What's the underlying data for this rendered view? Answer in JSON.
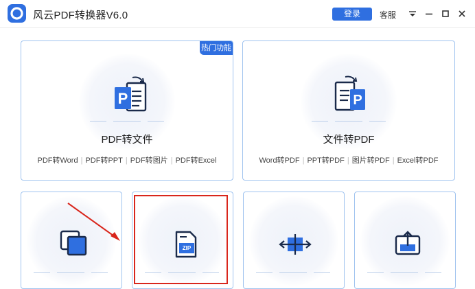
{
  "app": {
    "title": "风云PDF转换器V6.0",
    "login_label": "登录",
    "service_label": "客服"
  },
  "cards": {
    "pdf_to_file": {
      "title": "PDF转文件",
      "badge": "热门功能",
      "options": [
        "PDF转Word",
        "PDF转PPT",
        "PDF转图片",
        "PDF转Excel"
      ]
    },
    "file_to_pdf": {
      "title": "文件转PDF",
      "options": [
        "Word转PDF",
        "PPT转PDF",
        "图片转PDF",
        "Excel转PDF"
      ]
    },
    "zip_icon_text": "ZIP"
  },
  "colors": {
    "accent": "#2f6fe0",
    "card_border": "#9fc3ef",
    "highlight": "#d9261c"
  },
  "icons": {
    "window_controls": [
      "menu-icon",
      "minimize-icon",
      "maximize-icon",
      "close-icon"
    ],
    "cards": [
      "pdf-to-file-icon",
      "file-to-pdf-icon",
      "copy-icon",
      "zip-icon",
      "split-icon",
      "upload-icon"
    ]
  }
}
